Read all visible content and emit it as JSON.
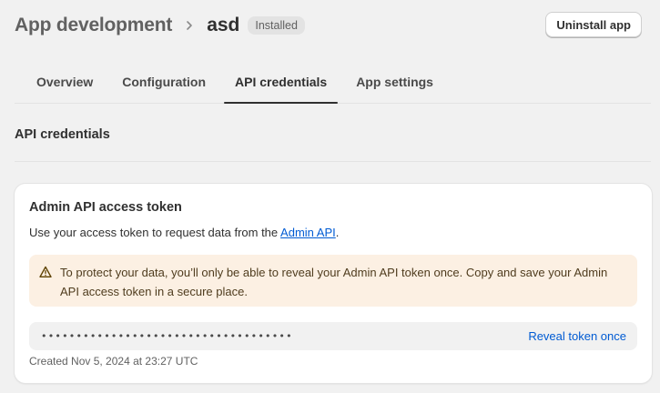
{
  "header": {
    "breadcrumb_parent": "App development",
    "breadcrumb_current": "asd",
    "status_badge": "Installed",
    "uninstall_label": "Uninstall app"
  },
  "tabs": [
    {
      "label": "Overview",
      "active": false
    },
    {
      "label": "Configuration",
      "active": false
    },
    {
      "label": "API credentials",
      "active": true
    },
    {
      "label": "App settings",
      "active": false
    }
  ],
  "section": {
    "title": "API credentials"
  },
  "card": {
    "title": "Admin API access token",
    "description_prefix": "Use your access token to request data from the ",
    "description_link": "Admin API",
    "description_suffix": ".",
    "warning": "To protect your data, you’ll only be able to reveal your Admin API token once. Copy and save your Admin API access token in a secure place.",
    "token_masked": "••••••••••••••••••••••••••••••••••••",
    "reveal_label": "Reveal token once",
    "created": "Created Nov 5, 2024 at 23:27 UTC"
  },
  "colors": {
    "background": "#f1f1f1",
    "link": "#005bd3",
    "warning_bg": "#fcf0e3",
    "warning_icon": "#5e4200"
  },
  "icons": {
    "breadcrumb_separator": "chevron-right-icon",
    "warning": "alert-triangle-icon"
  }
}
